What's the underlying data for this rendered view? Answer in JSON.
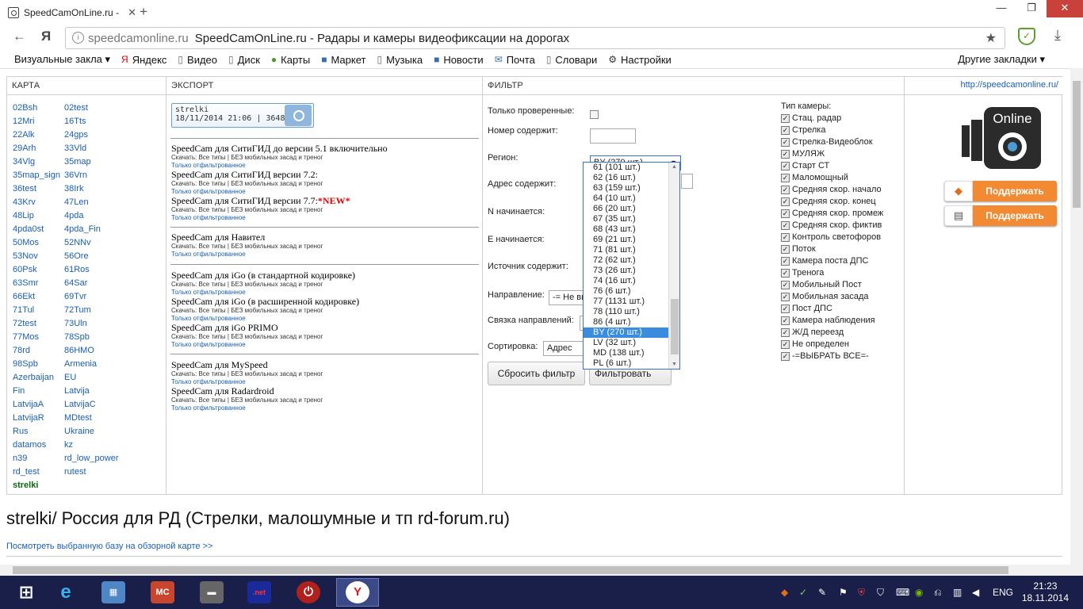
{
  "browser": {
    "tab_title": "SpeedCamOnLine.ru -",
    "tab_close": "✕",
    "new_tab": "+",
    "address_domain": "speedcamonline.ru",
    "address_title": "SpeedCamOnLine.ru - Радары и камеры видеофиксации на дорогах",
    "bookmarks": [
      {
        "label": "Визуальные закла ▾",
        "icon": ""
      },
      {
        "label": "Яндекс",
        "icon": "Я"
      },
      {
        "label": "Видео",
        "icon": "▯"
      },
      {
        "label": "Диск",
        "icon": "▯"
      },
      {
        "label": "Карты",
        "icon": "●"
      },
      {
        "label": "Маркет",
        "icon": "■"
      },
      {
        "label": "Музыка",
        "icon": "▯"
      },
      {
        "label": "Новости",
        "icon": "■"
      },
      {
        "label": "Почта",
        "icon": "✉"
      },
      {
        "label": "Словари",
        "icon": "▯"
      },
      {
        "label": "Настройки",
        "icon": "⚙"
      }
    ],
    "other_bookmarks": "Другие закладки ▾"
  },
  "columns": {
    "map": "КАРТА",
    "export": "ЭКСПОРТ",
    "filter": "ФИЛЬТР",
    "site_url": "http://speedcamonline.ru/"
  },
  "map_left": [
    "02Bsh",
    "12Mri",
    "22Alk",
    "29Arh",
    "34Vlg",
    "35map_sign",
    "36test",
    "43Krv",
    "48Lip",
    "4pda0st",
    "50Mos",
    "53Nov",
    "60Psk",
    "63Smr",
    "66Ekt",
    "71Tul",
    "72test",
    "77Mos",
    "78rd",
    "98Spb",
    "Azerbaijan",
    "Fin",
    "LatvijaA",
    "LatvijaR",
    "Rus",
    "datamos",
    "n39",
    "rd_test"
  ],
  "map_right": [
    "02test",
    "16Tts",
    "24gps",
    "33Vld",
    "35map",
    "36Vrn",
    "38Irk",
    "47Len",
    "4pda",
    "4pda_Fin",
    "52NNv",
    "56Ore",
    "61Ros",
    "64Sar",
    "69Tvr",
    "72Tum",
    "73Uln",
    "78Spb",
    "86HMO",
    "Armenia",
    "EU",
    "Latvija",
    "LatvijaC",
    "MDtest",
    "Ukraine",
    "kz",
    "rd_low_power",
    "rutest"
  ],
  "map_current": "strelki",
  "export": {
    "logo_line1": "strelki",
    "logo_line2": "18/11/2014 21:06 | 3648",
    "sub_links": "Скачать: Все типы | БЕЗ мобильных засад и треног",
    "sub_filtered": "Только отфильтрованное",
    "new_label": "*NEW*",
    "items": [
      "SpeedCam для СитиГИД до версии 5.1 включительно",
      "SpeedCam для СитиГИД версии 7.2:",
      "SpeedCam для СитиГИД версии 7.7:",
      "SpeedCam для Навител",
      "SpeedCam для iGo (в стандартной кодировке)",
      "SpeedCam для iGo (в расширенной кодировке)",
      "SpeedCam для iGo PRIMO",
      "SpeedCam для MySpeed",
      "SpeedCam для Radardroid"
    ]
  },
  "filter": {
    "only_verified": "Только проверенные:",
    "number_contains": "Номер содержит:",
    "region": "Регион:",
    "region_value": "BY (270 шт.)",
    "address_contains": "Адрес содержит:",
    "n_starts": "N начинается:",
    "e_starts": "E начинается:",
    "source_contains": "Источник содержит:",
    "direction": "Направление:",
    "direction_value": "-= Не вы",
    "link_directions": "Связка направлений:",
    "link_value": "-",
    "sort": "Сортировка:",
    "sort_value": "Адрес",
    "reset": "Сбросить фильтр",
    "apply": "Фильтровать",
    "region_options": [
      "61 (101 шт.)",
      "62 (16 шт.)",
      "63 (159 шт.)",
      "64 (10 шт.)",
      "66 (20 шт.)",
      "67 (35 шт.)",
      "68 (43 шт.)",
      "69 (21 шт.)",
      "71 (81 шт.)",
      "72 (62 шт.)",
      "73 (26 шт.)",
      "74 (16 шт.)",
      "76 (6 шт.)",
      "77 (1131 шт.)",
      "78 (110 шт.)",
      "86 (4 шт.)",
      "BY (270 шт.)",
      "LV (32 шт.)",
      "MD (138 шт.)",
      "PL (6 шт.)"
    ],
    "camera_type_label": "Тип камеры:",
    "camera_types": [
      "Стац. радар",
      "Стрелка",
      "Стрелка-Видеоблок",
      "МУЛЯЖ",
      "Старт СТ",
      "Маломощный",
      "Средняя скор. начало",
      "Средняя скор. конец",
      "Средняя скор. промеж",
      "Средняя скор. фиктив",
      "Контроль светофоров",
      "Поток",
      "Камера поста ДПС",
      "Тренога",
      "Мобильный Пост",
      "Мобильная засада",
      "Пост ДПС",
      "Камера наблюдения",
      "Ж/Д переезд",
      "Не определен",
      "-=ВЫБРАТЬ ВСЕ=-"
    ]
  },
  "support_button": "Поддержать",
  "logo_text": "Online",
  "heading": "strelki/ Россия для РД (Стрелки, малошумные и тп rd-forum.ru)",
  "view_link": "Посмотреть выбранную базу на обзорной карте >>",
  "taskbar": {
    "lang": "ENG",
    "time": "21:23",
    "date": "18.11.2014"
  },
  "colors": {
    "accent": "#3a8dde",
    "support": "#f18a32",
    "taskbar": "#1a1f4a"
  }
}
